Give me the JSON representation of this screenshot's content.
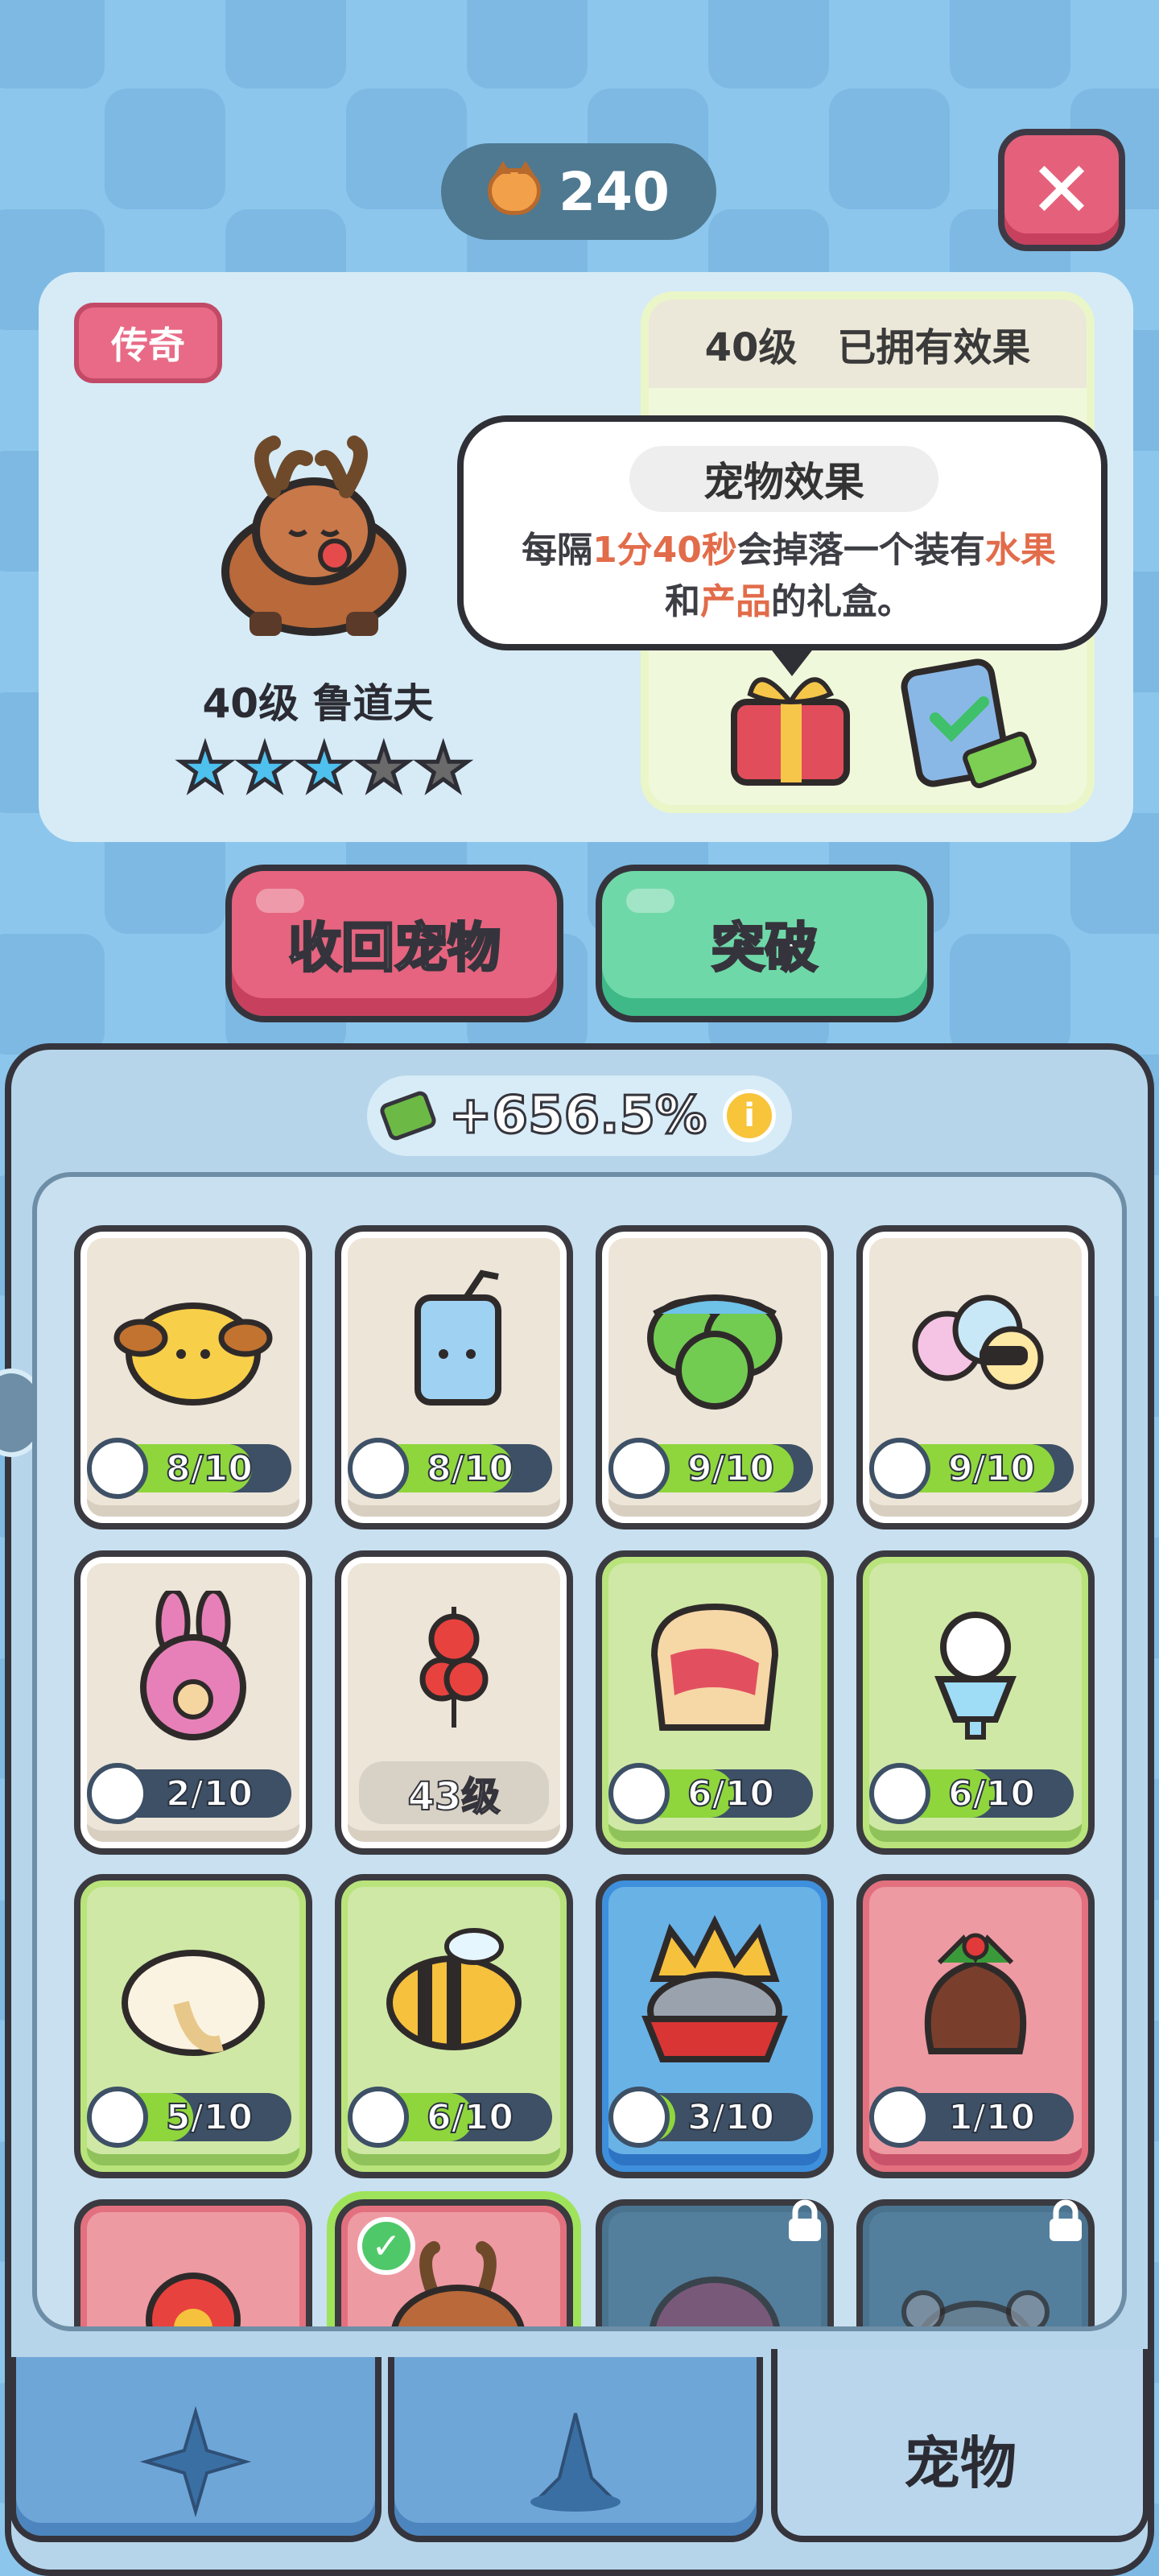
{
  "currency": {
    "amount": "240",
    "icon": "cat-coin-icon"
  },
  "header": {
    "close_icon": "close-icon"
  },
  "pet": {
    "rarity": "传奇",
    "name": "40级 鲁道夫",
    "stars_filled": 3,
    "stars_total": 5
  },
  "effects": {
    "level_label": "40级",
    "owned_label": "已拥有效果",
    "icons": [
      "gift-box-icon",
      "clipboard-cash-icon"
    ]
  },
  "tooltip": {
    "title": "宠物效果",
    "text_parts": [
      "每隔",
      "1分40秒",
      "会掉落一个装有",
      "水果",
      "和",
      "产品",
      "的礼盒。"
    ]
  },
  "actions": {
    "recall": "收回宠物",
    "breakthrough": "突破"
  },
  "bonus": {
    "value": "+656.5%"
  },
  "pets": [
    {
      "id": "dog",
      "progress": "8/10",
      "fill": 0.8,
      "color": "beige"
    },
    {
      "id": "milk",
      "progress": "8/10",
      "fill": 0.8,
      "color": "beige"
    },
    {
      "id": "clover",
      "progress": "9/10",
      "fill": 0.9,
      "color": "beige"
    },
    {
      "id": "sheep",
      "progress": "9/10",
      "fill": 0.9,
      "color": "beige"
    },
    {
      "id": "bunny",
      "progress": "2/10",
      "fill": 0.2,
      "color": "beige"
    },
    {
      "id": "candy",
      "level": "43级",
      "color": "beige"
    },
    {
      "id": "toast",
      "progress": "6/10",
      "fill": 0.6,
      "color": "green"
    },
    {
      "id": "cat-parfait",
      "progress": "6/10",
      "fill": 0.6,
      "color": "green"
    },
    {
      "id": "hamster",
      "progress": "5/10",
      "fill": 0.5,
      "color": "green"
    },
    {
      "id": "bee",
      "progress": "6/10",
      "fill": 0.6,
      "color": "green"
    },
    {
      "id": "king",
      "progress": "3/10",
      "fill": 0.3,
      "color": "blue"
    },
    {
      "id": "pudding",
      "progress": "1/10",
      "fill": 0.1,
      "color": "red"
    }
  ],
  "nav": {
    "tab3_label": "宠物"
  }
}
